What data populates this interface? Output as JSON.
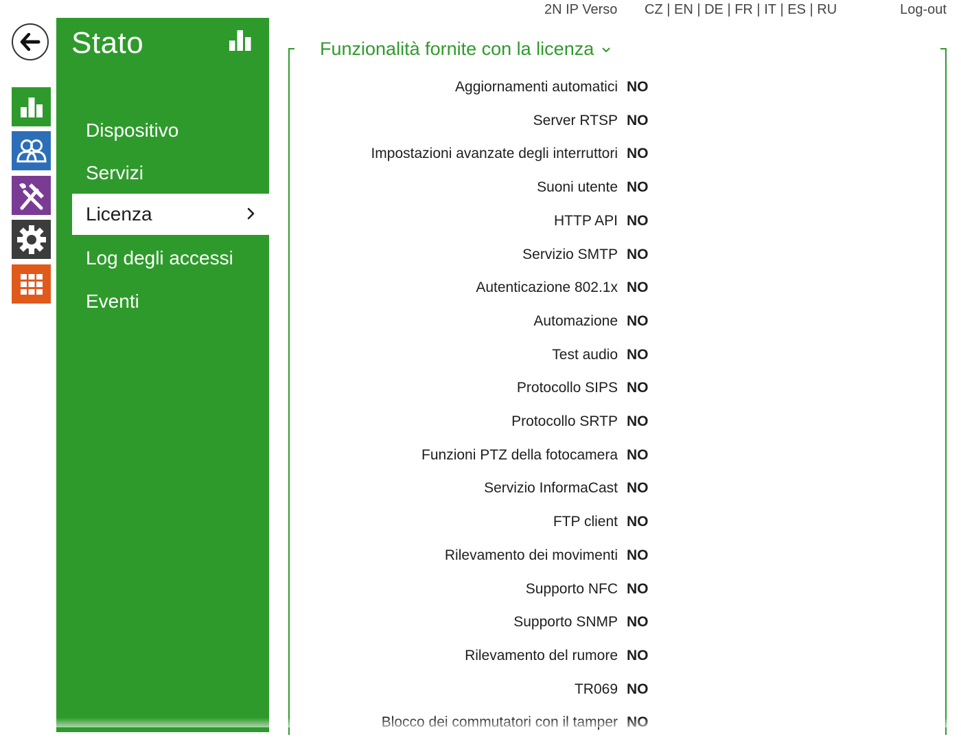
{
  "topbar": {
    "device_name": "2N IP Verso",
    "languages": [
      "CZ",
      "EN",
      "DE",
      "FR",
      "IT",
      "ES",
      "RU"
    ],
    "logout_label": "Log-out"
  },
  "rail": {
    "items": [
      {
        "icon": "bar-chart-icon",
        "color": "#2f9a2c"
      },
      {
        "icon": "users-icon",
        "color": "#2c6fb8"
      },
      {
        "icon": "tools-icon",
        "color": "#7a3b95"
      },
      {
        "icon": "gear-icon",
        "color": "#3c3c3c"
      },
      {
        "icon": "grid-icon",
        "color": "#e05a1c"
      }
    ]
  },
  "sidebar": {
    "title": "Stato",
    "items": [
      {
        "label": "Dispositivo"
      },
      {
        "label": "Servizi"
      },
      {
        "label": "Licenza",
        "active": true
      },
      {
        "label": "Log degli accessi"
      },
      {
        "label": "Eventi"
      }
    ]
  },
  "main": {
    "section_title": "Funzionalità fornite con la licenza",
    "features": [
      {
        "label": "Aggiornamenti automatici",
        "value": "NO"
      },
      {
        "label": "Server RTSP",
        "value": "NO"
      },
      {
        "label": "Impostazioni avanzate degli interruttori",
        "value": "NO"
      },
      {
        "label": "Suoni utente",
        "value": "NO"
      },
      {
        "label": "HTTP API",
        "value": "NO"
      },
      {
        "label": "Servizio SMTP",
        "value": "NO"
      },
      {
        "label": "Autenticazione 802.1x",
        "value": "NO"
      },
      {
        "label": "Automazione",
        "value": "NO"
      },
      {
        "label": "Test audio",
        "value": "NO"
      },
      {
        "label": "Protocollo SIPS",
        "value": "NO"
      },
      {
        "label": "Protocollo SRTP",
        "value": "NO"
      },
      {
        "label": "Funzioni PTZ della fotocamera",
        "value": "NO"
      },
      {
        "label": "Servizio InformaCast",
        "value": "NO"
      },
      {
        "label": "FTP client",
        "value": "NO"
      },
      {
        "label": "Rilevamento dei movimenti",
        "value": "NO"
      },
      {
        "label": "Supporto NFC",
        "value": "NO"
      },
      {
        "label": "Supporto SNMP",
        "value": "NO"
      },
      {
        "label": "Rilevamento del rumore",
        "value": "NO"
      },
      {
        "label": "TR069",
        "value": "NO"
      },
      {
        "label": "Blocco dei commutatori con il tamper",
        "value": "NO"
      }
    ]
  },
  "colors": {
    "accent": "#2f9a2c",
    "users": "#2c6fb8",
    "tools": "#7a3b95",
    "settings": "#3c3c3c",
    "apps": "#e05a1c"
  }
}
